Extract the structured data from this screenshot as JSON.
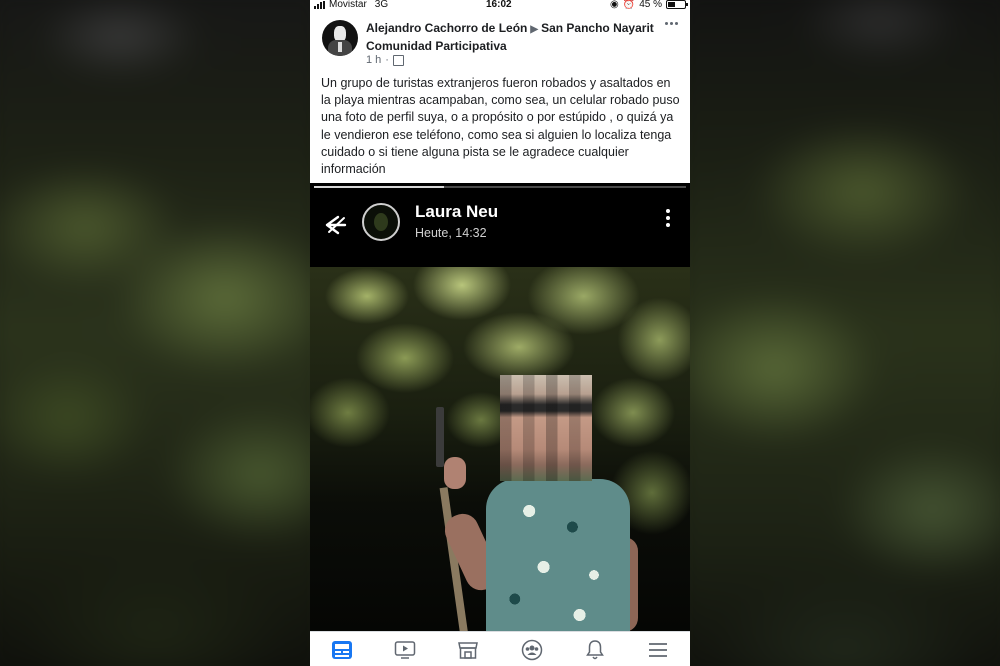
{
  "status_bar": {
    "carrier": "Movistar",
    "network": "3G",
    "time": "16:02",
    "battery": "45 %"
  },
  "post": {
    "author": "Alejandro Cachorro de León",
    "group": "San Pancho Nayarit Comunidad Participativa",
    "time": "1 h",
    "text": "Un grupo de turistas extranjeros fueron robados y asaltados en la playa mientras acampaban, como sea, un celular robado puso una foto de perfil suya, o a propósito o por estúpido , o quizá ya le vendieron ese teléfono, como sea si alguien lo localiza tenga cuidado o si tiene alguna pista se le agradece cualquier información"
  },
  "shared_story": {
    "name": "Laura Neu",
    "time": "Heute, 14:32",
    "progress_fraction": 0.35
  },
  "bottom_nav": [
    {
      "icon": "news-feed-icon",
      "active": true
    },
    {
      "icon": "watch-icon",
      "active": false
    },
    {
      "icon": "marketplace-icon",
      "active": false
    },
    {
      "icon": "groups-icon",
      "active": false
    },
    {
      "icon": "notifications-bell-icon",
      "active": false
    },
    {
      "icon": "menu-icon",
      "active": false
    }
  ],
  "colors": {
    "accent": "#1877f2",
    "text": "#1c1e21",
    "muted": "#606770"
  }
}
